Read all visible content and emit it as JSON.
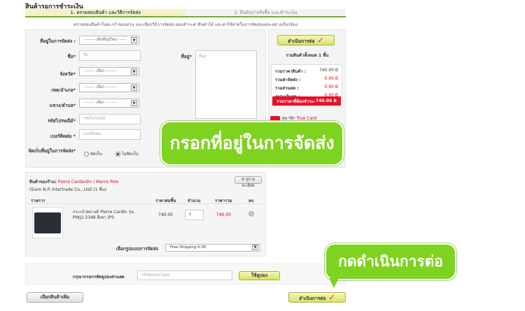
{
  "page": {
    "title": "สินค้ารอการชำระเงิน"
  },
  "steps": [
    {
      "label": "1. ตรวจสอบสินค้า และวิธีการจัดส่ง",
      "active": true
    },
    {
      "label": "2. ยืนยันการสั่งซื้อ และชำระเงิน",
      "active": false
    }
  ],
  "subtitle": "ตรวจสอบสินค้าในตะกร้าของท่าน และเลือกวิธีการจัดส่ง ผ่อนชำระค่าสินค้าได้ และค่าใช้จ่ายในการจัดส่งแต่ละอย่างเกี่ยวข้อง",
  "form": {
    "address_book_label": "ที่อยู่ในการจัดส่ง :",
    "address_book_value": "-------- เพิ่มที่อยู่ใหม่ ------",
    "name_label": "ชื่อ*",
    "name_placeholder": "ชื่อ",
    "address_label": "ที่อยู่*",
    "address_placeholder": "ที่อยู่",
    "province_label": "จังหวัด*",
    "province_value": "-------- เลือก --------",
    "district_label": "เขต/อำเภอ*",
    "district_value": "-------- เลือก --------",
    "subdistrict_label": "แขวง/ตำบล*",
    "subdistrict_value": "-------- เลือก --------",
    "postcode_label": "รหัสไปรษณีย์*",
    "postcode_placeholder": "รหัสไปรษณีย์",
    "phone_label": "เบอร์ติดต่อ *",
    "phone_placeholder": "เบอร์ติดต่อ",
    "tax_label": "จัดเก็บที่อยู่ในการจัดส่ง*",
    "tax_opt1": "จัดเก็บ",
    "tax_opt2": "ไม่จัดเก็บ"
  },
  "summary": {
    "continue_label": "ดำเนินการต่อ",
    "total_items_prefix": "รวมสินค้าทั้งหมด",
    "total_items_count": "1",
    "total_items_suffix": "ชิ้น",
    "rows": [
      {
        "label": "รวมราคาสินค้า :",
        "value": "740.00 B",
        "color": "#333333"
      },
      {
        "label": "รวมค่าจัดส่ง :",
        "value": "0.00 B",
        "color": "#d00000"
      },
      {
        "label": "รวมส่วนลด :",
        "value": "0.00 B",
        "color": "#d00000"
      },
      {
        "label": "คูปองเงินสด :",
        "value": "0.00 B",
        "color": "#d00000"
      }
    ],
    "grand_label": "รวมราคาที่ต้องชำระ:",
    "grand_value": "740.00 B",
    "member_prefix": "สมาชิก",
    "member_link": "True Card",
    "member_note": "ณ"
  },
  "callouts": {
    "address": "กรอกที่อยู่ในการจัดส่ง",
    "continue": "กดดำเนินการต่อ"
  },
  "shop": {
    "label": "สินค้าของร้าน:",
    "name": "Pierre Cardardin / Marco Polo",
    "company": "(Siam N.P. Intertrade Co., Ltd) (1 ชิ้น)",
    "view_button": "ดูรายละเอียด",
    "columns": {
      "item": "รายการ",
      "unit_price": "ราคาต่อชิ้น",
      "qty": "จำนวน",
      "total": "ราคารวม",
      "delete": "ลบ"
    },
    "items": [
      {
        "name": "กระเป๋าสตางค์ Pierre Cardin รุ่น PWJ2-3348 สีเทา (PI)",
        "unit_price": "740.00",
        "qty": "1",
        "total": "740.00"
      }
    ],
    "shipping_label": "เลือกรูปแบบการจัดส่ง",
    "shipping_value": "Free Shipping 0.00"
  },
  "coupon": {
    "label": "กรุณากรอกรหัสคูปองส่วนลด",
    "placeholder": "รหัสคูปองส่วนลด",
    "button": "ใช้คูปอง"
  },
  "footer": {
    "back_button": "เลือกสินค้าเพิ่ม",
    "continue_button": "ดำเนินการต่อ"
  }
}
